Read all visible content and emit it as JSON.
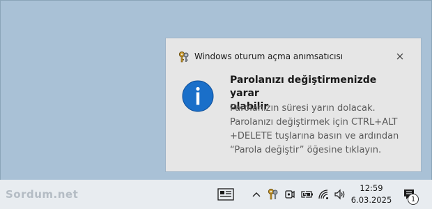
{
  "toast": {
    "app_name": "Windows oturum açma anımsatıcısı",
    "title_line1": "Parolanızı değiştirmenizde yarar",
    "title_line2": "olabilir",
    "body_lines": [
      "Parolanızın süresi yarın dolacak.",
      "Parolanızı değiştirmek için CTRL+ALT",
      "+DELETE tuşlarına basın ve ardından",
      "“Parola değiştir” öğesine tıklayın."
    ],
    "accent_color": "#1a6fc9"
  },
  "taskbar": {
    "watermark": "Sordum.net",
    "clock_time": "12:59",
    "clock_date": "6.03.2025",
    "notification_count": "1",
    "tray_icons": [
      "news-icon",
      "chevron-up-icon",
      "keys-icon",
      "meet-now-icon",
      "battery-icon",
      "wifi-icon",
      "volume-icon",
      "action-center-icon"
    ]
  }
}
